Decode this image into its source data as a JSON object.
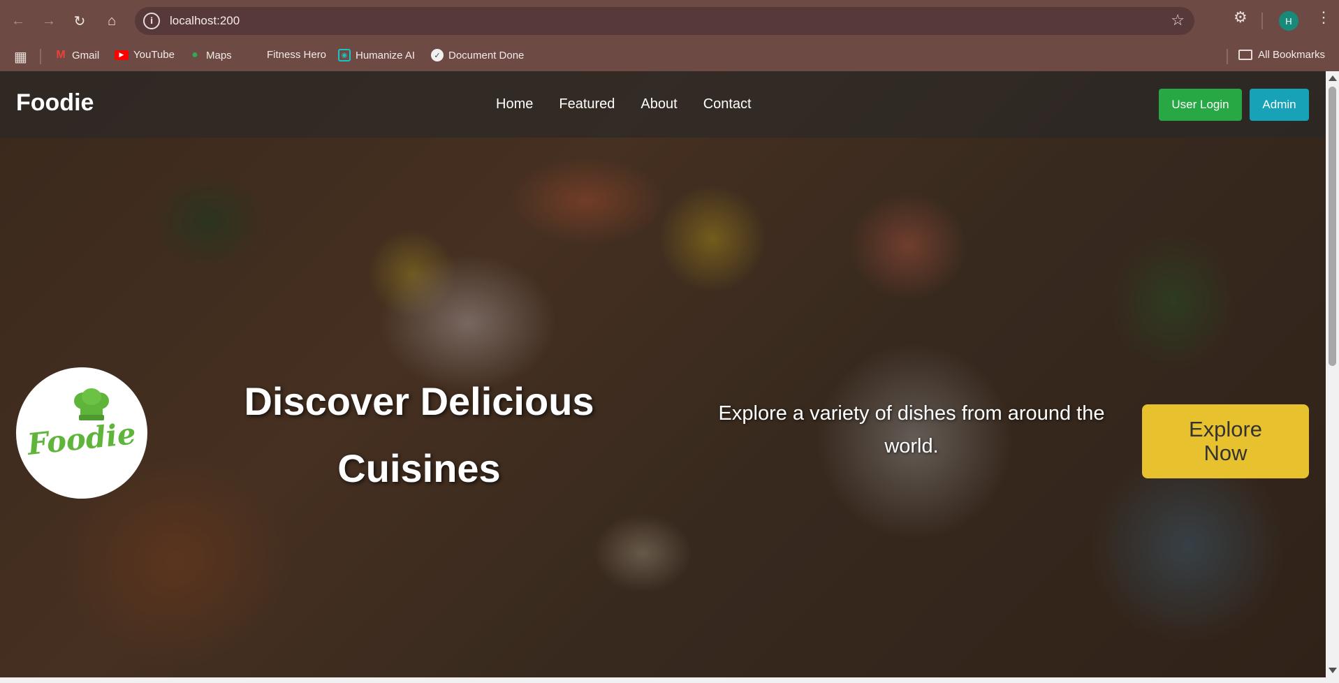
{
  "browser": {
    "url": "localhost:200",
    "profile_initial": "H",
    "bookmarks": [
      {
        "label": "Gmail",
        "icon": "gmail-icon"
      },
      {
        "label": "YouTube",
        "icon": "youtube-icon"
      },
      {
        "label": "Maps",
        "icon": "maps-icon"
      },
      {
        "label": "Fitness Hero",
        "icon": "none"
      },
      {
        "label": "Humanize AI",
        "icon": "humanize-icon"
      },
      {
        "label": "Document Done",
        "icon": "document-icon"
      }
    ],
    "all_bookmarks_label": "All Bookmarks"
  },
  "site": {
    "brand": "Foodie",
    "nav": [
      "Home",
      "Featured",
      "About",
      "Contact"
    ],
    "user_login_label": "User Login",
    "admin_label": "Admin",
    "logo_text": "Foodie",
    "hero_title_line1": "Discover Delicious",
    "hero_title_line2": "Cuisines",
    "hero_subtitle": "Explore a variety of dishes from around the world.",
    "explore_label": "Explore Now",
    "colors": {
      "user_login": "#28a745",
      "admin": "#17a2b8",
      "explore": "#e8c12e",
      "logo_green": "#5fb53a"
    }
  }
}
